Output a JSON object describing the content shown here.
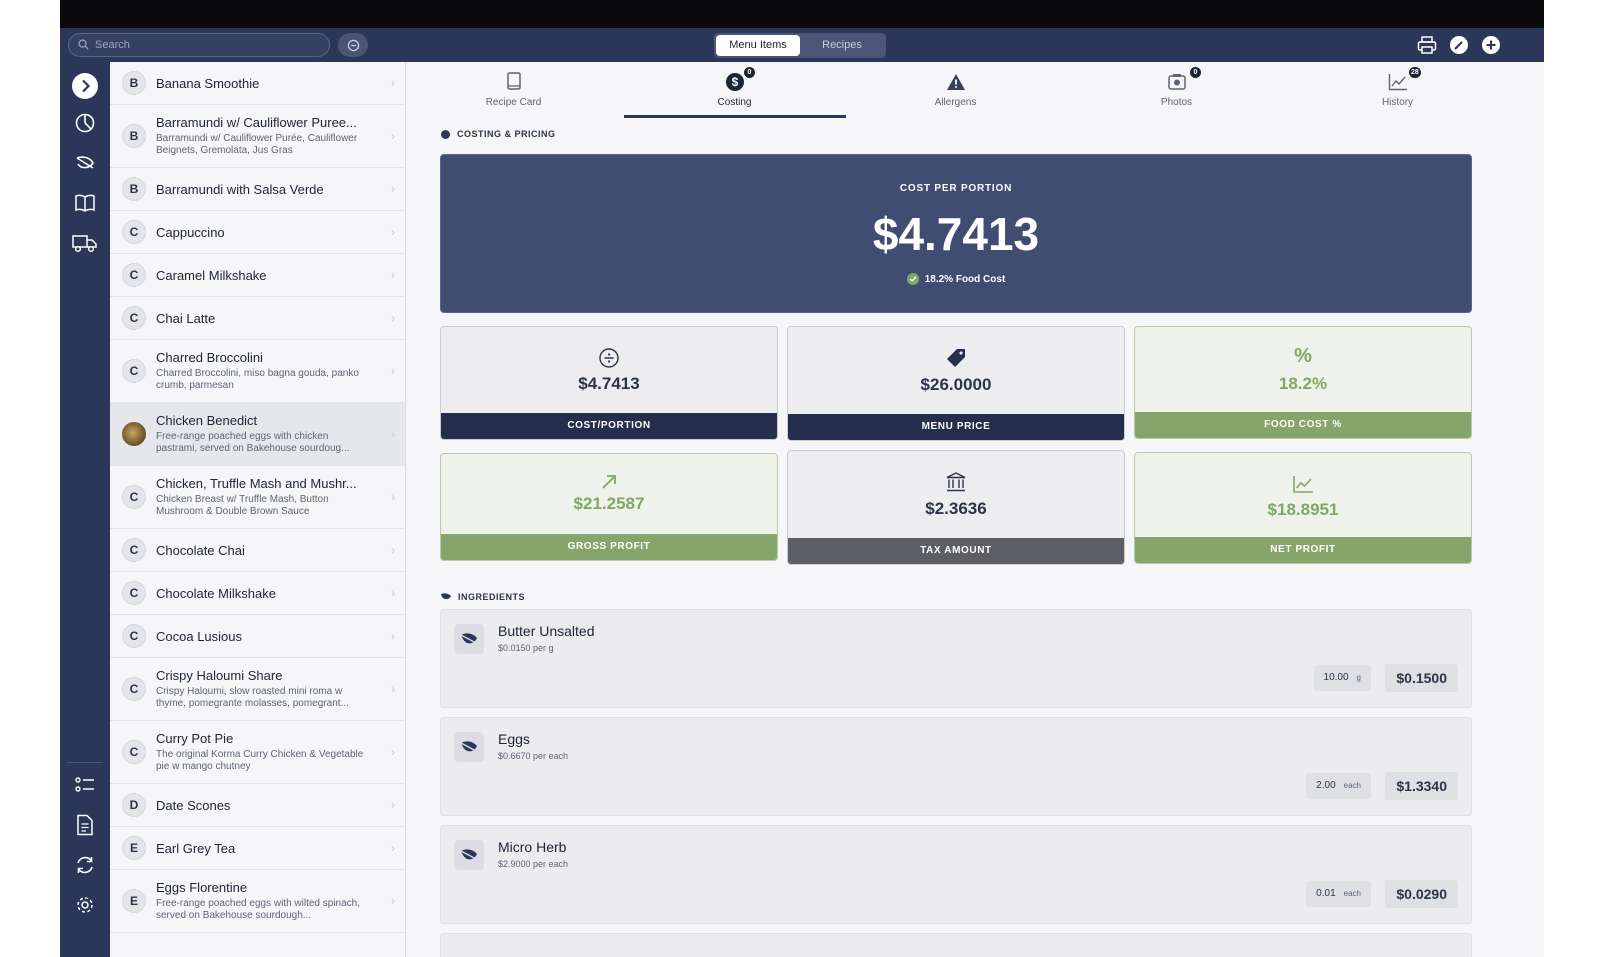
{
  "search": {
    "placeholder": "Search"
  },
  "segments": [
    "Menu Items",
    "Recipes"
  ],
  "items": [
    {
      "letter": "B",
      "title": "Banana Smoothie",
      "sub": ""
    },
    {
      "letter": "B",
      "title": "Barramundi w/ Cauliflower Puree...",
      "sub": "Barramundi w/ Cauliflower Purée, Cauliflower Beignets, Gremolata, Jus Gras"
    },
    {
      "letter": "B",
      "title": "Barramundi with Salsa Verde",
      "sub": ""
    },
    {
      "letter": "C",
      "title": "Cappuccino",
      "sub": ""
    },
    {
      "letter": "C",
      "title": "Caramel Milkshake",
      "sub": ""
    },
    {
      "letter": "C",
      "title": "Chai Latte",
      "sub": ""
    },
    {
      "letter": "C",
      "title": "Charred Broccolini",
      "sub": "Charred Broccolini, miso bagna gouda, panko crumb, parmesan"
    },
    {
      "letter": "",
      "title": "Chicken Benedict",
      "sub": "Free-range poached eggs with chicken pastrami, served on Bakehouse sourdoug..."
    },
    {
      "letter": "C",
      "title": "Chicken, Truffle Mash and Mushr...",
      "sub": "Chicken Breast w/ Truffle Mash, Button Mushroom & Double Brown Sauce"
    },
    {
      "letter": "C",
      "title": "Chocolate Chai",
      "sub": ""
    },
    {
      "letter": "C",
      "title": "Chocolate Milkshake",
      "sub": ""
    },
    {
      "letter": "C",
      "title": "Cocoa Lusious",
      "sub": ""
    },
    {
      "letter": "C",
      "title": "Crispy Haloumi Share",
      "sub": "Crispy Haloumi, slow roasted mini roma w thyme, pomegrante molasses, pomegrant..."
    },
    {
      "letter": "C",
      "title": "Curry Pot Pie",
      "sub": "The original Korma Curry Chicken & Vegetable pie w mango chutney"
    },
    {
      "letter": "D",
      "title": "Date Scones",
      "sub": ""
    },
    {
      "letter": "E",
      "title": "Earl Grey Tea",
      "sub": ""
    },
    {
      "letter": "E",
      "title": "Eggs Florentine",
      "sub": "Free-range poached eggs with wilted spinach, served on Bakehouse sourdough..."
    }
  ],
  "tabs": [
    {
      "label": "Recipe Card",
      "badge": ""
    },
    {
      "label": "Costing",
      "badge": "0"
    },
    {
      "label": "Allergens",
      "badge": ""
    },
    {
      "label": "Photos",
      "badge": "0"
    },
    {
      "label": "History",
      "badge": "28"
    }
  ],
  "costing": {
    "section_title": "COSTING & PRICING",
    "hero_label": "COST PER PORTION",
    "hero_value": "$4.7413",
    "hero_sub": "18.2% Food Cost",
    "cards": [
      {
        "value": "$4.7413",
        "label": "COST/PORTION"
      },
      {
        "value": "$26.0000",
        "label": "MENU PRICE"
      },
      {
        "value": "18.2%",
        "label": "FOOD COST %",
        "icon_text": "%"
      },
      {
        "value": "$21.2587",
        "label": "GROSS PROFIT"
      },
      {
        "value": "$2.3636",
        "label": "TAX AMOUNT"
      },
      {
        "value": "$18.8951",
        "label": "NET PROFIT"
      }
    ]
  },
  "ingredients": {
    "section_title": "INGREDIENTS",
    "rows": [
      {
        "name": "Butter Unsalted",
        "price": "$0.0150 per g",
        "qty": "10.00",
        "unit": "g",
        "cost": "$0.1500"
      },
      {
        "name": "Eggs",
        "price": "$0.6670 per each",
        "qty": "2.00",
        "unit": "each",
        "cost": "$1.3340"
      },
      {
        "name": "Micro Herb",
        "price": "$2.9000 per each",
        "qty": "0.01",
        "unit": "each",
        "cost": "$0.0290"
      }
    ]
  },
  "colors": {
    "navy": "#2c3658",
    "hero": "#414c72",
    "green": "#85a56b",
    "grey_footer": "#5c5e63"
  }
}
